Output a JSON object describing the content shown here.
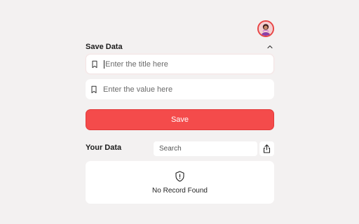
{
  "avatar": {
    "icon": "user-avatar",
    "border_color": "#e84545"
  },
  "save_section": {
    "title": "Save Data",
    "collapse_icon": "chevron-up-icon",
    "title_field": {
      "placeholder": "Enter the title here",
      "value": "",
      "icon": "bookmark-icon"
    },
    "value_field": {
      "placeholder": "Enter the value here",
      "value": "",
      "icon": "bookmark-icon"
    },
    "save_label": "Save",
    "accent": "#f44b4b"
  },
  "data_section": {
    "title": "Your Data",
    "search": {
      "placeholder": "Search",
      "value": ""
    },
    "share_icon": "share-icon",
    "empty_icon": "shield-alert-icon",
    "empty_message": "No Record Found"
  }
}
